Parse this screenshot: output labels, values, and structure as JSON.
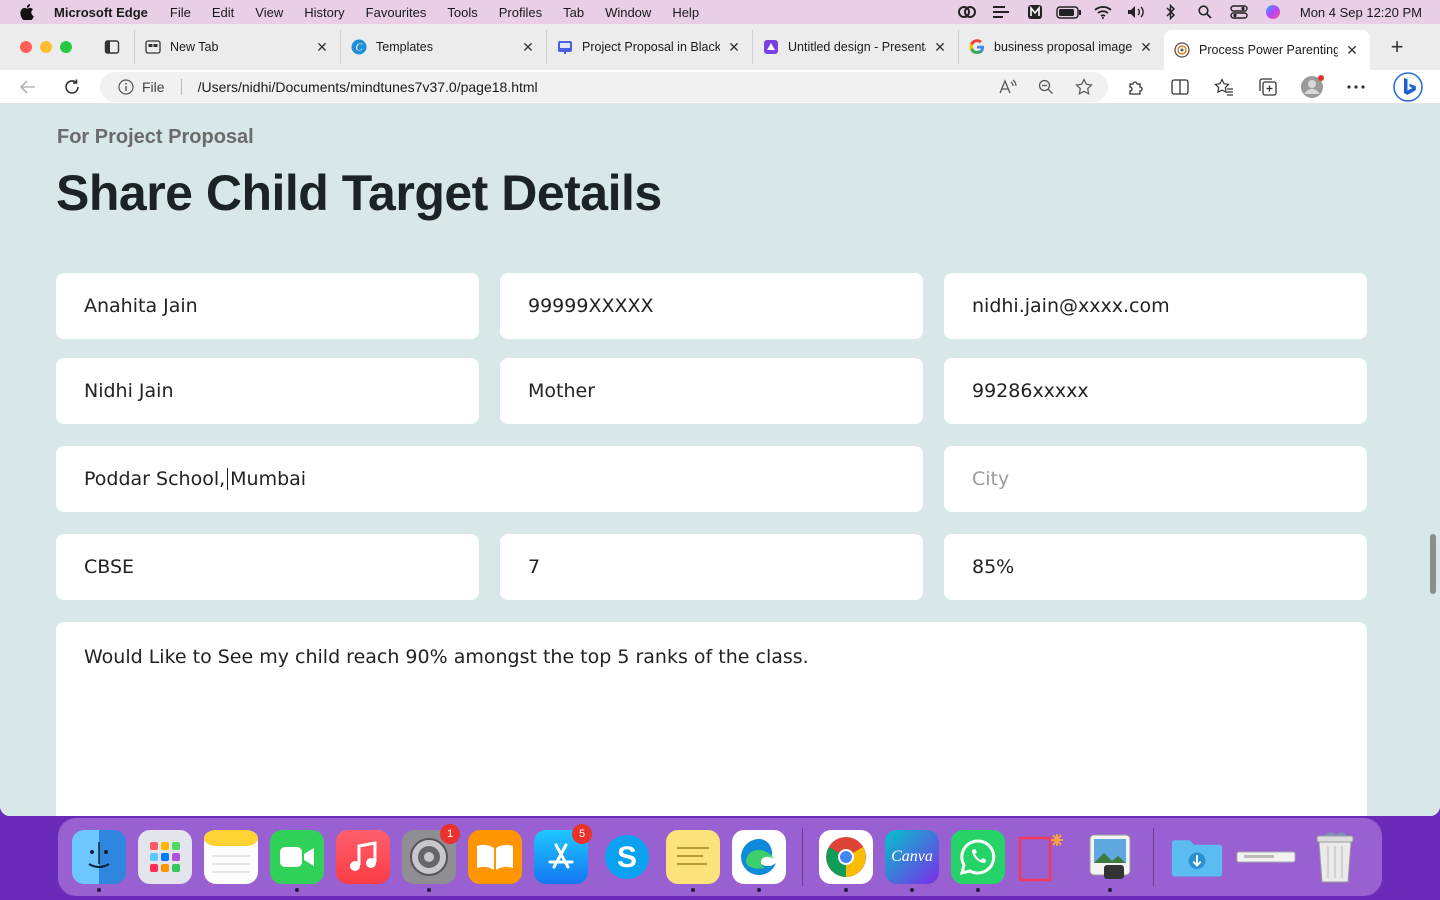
{
  "menubar": {
    "app_name": "Microsoft Edge",
    "items": [
      "File",
      "Edit",
      "View",
      "History",
      "Favourites",
      "Tools",
      "Profiles",
      "Tab",
      "Window",
      "Help"
    ],
    "clock": "Mon 4 Sep  12:20 PM"
  },
  "tabs": [
    {
      "label": "New Tab",
      "icon": "new-tab-icon"
    },
    {
      "label": "Templates",
      "icon": "canva-icon"
    },
    {
      "label": "Project Proposal in Black",
      "icon": "slides-icon"
    },
    {
      "label": "Untitled design - Presentation",
      "icon": "canva-design-icon"
    },
    {
      "label": "business proposal images",
      "icon": "google-icon"
    },
    {
      "label": "Process Power Parenting",
      "icon": "site-icon",
      "active": true
    }
  ],
  "address": {
    "file_label": "File",
    "url": "/Users/nidhi/Documents/mindtunes7v37.0/page18.html"
  },
  "page": {
    "eyebrow": "For Project Proposal",
    "title": "Share Child Target Details",
    "fields": {
      "child_name": "Anahita Jain",
      "child_phone": "99999XXXXX",
      "email": "nidhi.jain@xxxx.com",
      "parent_name": "Nidhi Jain",
      "relation": "Mother",
      "parent_phone": "99286xxxxx",
      "school_before_caret": "Poddar School,",
      "school_after_caret": "Mumbai",
      "city_placeholder": "City",
      "board": "CBSE",
      "grade": "7",
      "score": "85%",
      "goal": "Would Like to See my child reach 90% amongst the top 5 ranks of the class."
    }
  },
  "dock": {
    "apps": [
      "Finder",
      "Launchpad",
      "Notes",
      "FaceTime",
      "Music",
      "System Settings",
      "Books",
      "App Store",
      "Skype",
      "Stickies",
      "Microsoft Edge",
      "Google Chrome",
      "Canva",
      "WhatsApp",
      "Screenshot",
      "Preview",
      "Downloads",
      "Trash"
    ],
    "badges": {
      "settings": "1",
      "appstore": "5"
    },
    "canva_text": "Canva"
  }
}
